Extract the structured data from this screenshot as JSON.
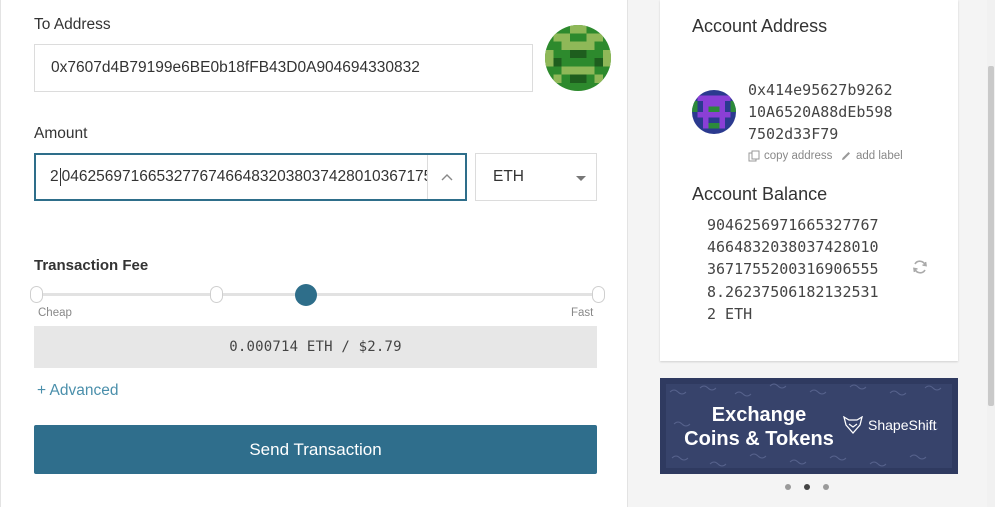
{
  "send_form": {
    "to_address_label": "To Address",
    "to_address_value": "0x7607d4B79199e6BE0b18fFB43D0A904694330832",
    "amount_label": "Amount",
    "amount_value_prefix": "2",
    "amount_value_rest": "0462569716653277674664832038037428010367175",
    "currency_selected": "ETH",
    "fee_label": "Transaction Fee",
    "fee_slider_level": 0.5,
    "fee_slider_cheap": "Cheap",
    "fee_slider_fast": "Fast",
    "fee_value": "0.000714 ETH / $2.79",
    "advanced_link": "+ Advanced",
    "send_button": "Send Transaction"
  },
  "account": {
    "address_heading": "Account Address",
    "address_lines": "0x414e95627b9262\n10A6520A88dEb598\n7502d33F79",
    "copy_address": "copy address",
    "add_label": "add label",
    "balance_heading": "Account Balance",
    "balance_lines": "9046256971665327767\n4664832038037428010\n3671755200316906555\n8.26237506182132531\n2 ETH"
  },
  "ad": {
    "title": "Exchange Coins & Tokens",
    "brand": "ShapeShift"
  },
  "carousel": {
    "count": 3,
    "active_index": 1
  },
  "colors": {
    "accent": "#2f6e8c",
    "ad_background": "#2f3a60",
    "to_identicon": "#2d8a2d",
    "account_identicon": "#8a3fd6"
  },
  "icons": {
    "copy": "copy-icon",
    "pencil": "pencil-icon",
    "refresh": "refresh-icon",
    "fox": "shapeshift-fox-icon"
  }
}
